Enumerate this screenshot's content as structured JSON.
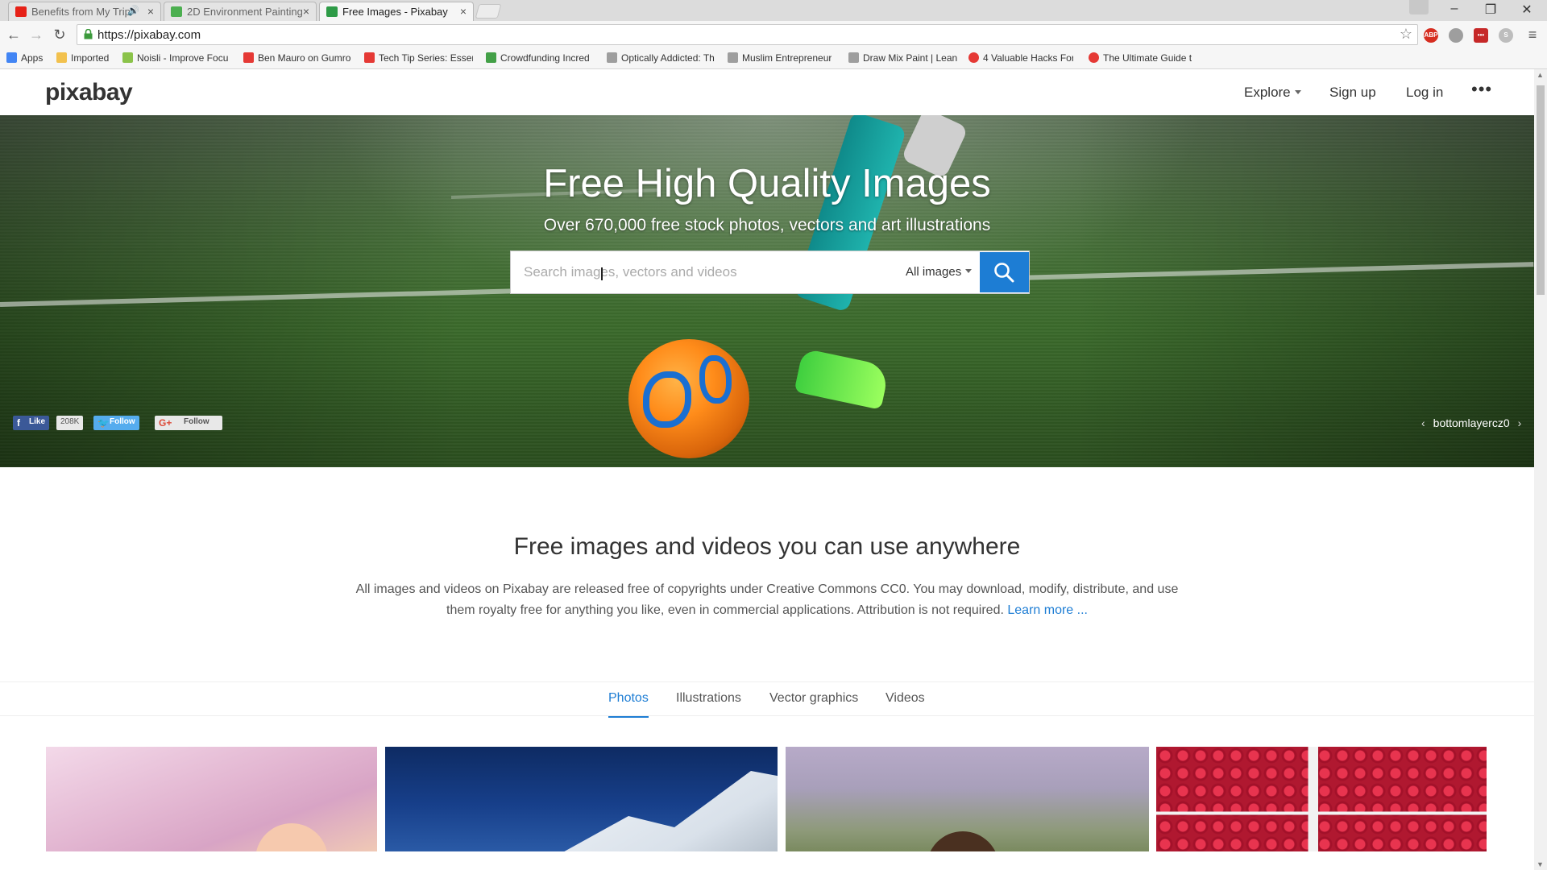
{
  "browser": {
    "tabs": [
      {
        "title": "Benefits from My Trip",
        "color": "#e62117",
        "audio": true
      },
      {
        "title": "2D Environment Painting",
        "color": "#4caf50",
        "audio": false
      },
      {
        "title": "Free Images - Pixabay",
        "color": "#2e9b47",
        "audio": false,
        "active": true
      }
    ],
    "url": "https://pixabay.com",
    "window_controls": {
      "minimize": "–",
      "restore": "❐",
      "close": "✕"
    },
    "extensions": [
      {
        "name": "ABP",
        "color": "#d62d20"
      },
      {
        "name": "",
        "color": "#9e9e9e"
      },
      {
        "name": "•••",
        "color": "#c62828"
      },
      {
        "name": "S",
        "color": "#bdbdbd"
      }
    ],
    "bookmarks": [
      {
        "label": "Apps",
        "color": "#4285f4"
      },
      {
        "label": "Imported",
        "color": "#f2c14e"
      },
      {
        "label": "Noisli - Improve Focu",
        "color": "#8bc34a"
      },
      {
        "label": "Ben Mauro on Gumro",
        "color": "#e53935"
      },
      {
        "label": "Tech Tip Series: Essen",
        "color": "#e53935"
      },
      {
        "label": "Crowdfunding Incred",
        "color": "#43a047"
      },
      {
        "label": "Optically Addicted: Th",
        "color": "#9e9e9e"
      },
      {
        "label": "Muslim Entrepreneur",
        "color": "#9e9e9e"
      },
      {
        "label": "Draw Mix Paint | Lean",
        "color": "#9e9e9e"
      },
      {
        "label": "4 Valuable Hacks For",
        "color": "#e53935"
      },
      {
        "label": "The Ultimate Guide t",
        "color": "#e53935"
      }
    ]
  },
  "header": {
    "logo": "pixabay",
    "nav": {
      "explore": "Explore",
      "signup": "Sign up",
      "login": "Log in",
      "more": "•••"
    }
  },
  "hero": {
    "title": "Free High Quality Images",
    "subtitle": "Over 670,000 free stock photos, vectors and art illustrations",
    "search": {
      "placeholder": "Search images, vectors and videos",
      "type": "All images"
    },
    "social": {
      "like": "Like",
      "like_count": "208K",
      "twitter": "Follow",
      "gplus": "Follow"
    },
    "credit": {
      "prev": "‹",
      "name": "bottomlayercz0",
      "next": "›"
    }
  },
  "intro": {
    "title": "Free images and videos you can use anywhere",
    "text": "All images and videos on Pixabay are released free of copyrights under Creative Commons CC0. You may download, modify, distribute, and use them royalty free for anything you like, even in commercial applications. Attribution is not required.",
    "link": "Learn more ..."
  },
  "tabs": [
    "Photos",
    "Illustrations",
    "Vector graphics",
    "Videos"
  ],
  "accent_color": "#1d7dd4"
}
